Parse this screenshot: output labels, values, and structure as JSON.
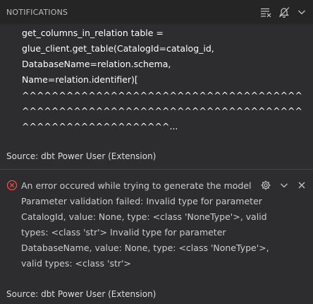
{
  "header": {
    "title": "NOTIFICATIONS",
    "icons": [
      "clear-all-icon",
      "do-not-disturb-icon",
      "chevron-down-icon"
    ]
  },
  "notification_1": {
    "lines": [
      "get_columns_in_relation table =",
      "glue_client.get_table(CatalogId=catalog_id,",
      "DatabaseName=relation.schema,",
      "Name=relation.identifier)[",
      "^^^^^^^^^^^^^^^^^^^^^^^^^^^^^^^^^^^^^^",
      "^^^^^^^^^^^^^^^^^^^^^^^^^^^^^^^^^^^^^^",
      "^^^^^^^^^^^^^^^^^^^^..."
    ],
    "source": "Source: dbt Power User (Extension)"
  },
  "notification_2": {
    "severity": "error",
    "lines": [
      "An error occured while trying to generate the model",
      "Parameter validation failed: Invalid type for parameter",
      "CatalogId, value: None, type: <class 'NoneType'>, valid",
      "types: <class 'str'> Invalid type for parameter",
      "DatabaseName, value: None, type: <class 'NoneType'>,",
      "valid types: <class 'str'>"
    ],
    "source": "Source: dbt Power User (Extension)",
    "icons": [
      "error-icon",
      "gear-icon",
      "chevron-down-icon",
      "close-icon"
    ]
  },
  "colors": {
    "background": "#252526",
    "toast_background": "#2d2d30",
    "error": "#f14c4c",
    "text": "#cccccc",
    "code_text": "#ffffff"
  }
}
